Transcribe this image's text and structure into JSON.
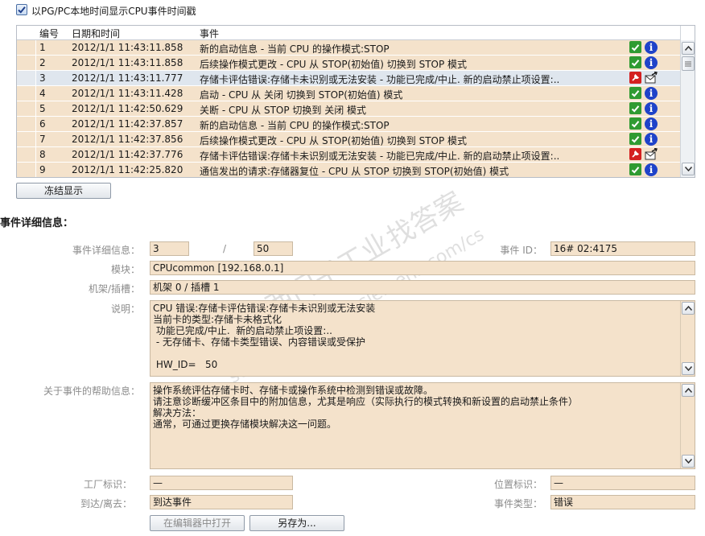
{
  "options": {
    "show_local_time_label": "以PG/PC本地时间显示CPU事件时间戳",
    "show_local_time_checked": true
  },
  "events_table": {
    "columns": [
      "编号",
      "日期和时间",
      "事件"
    ],
    "selected_row": 2,
    "rows": [
      {
        "num": "1",
        "datetime": "2012/1/1 11:43:11.858",
        "event": "新的启动信息 - 当前 CPU 的操作模式:STOP",
        "status": "ok"
      },
      {
        "num": "2",
        "datetime": "2012/1/1 11:43:11.858",
        "event": "后续操作模式更改  - CPU 从 STOP(初始值) 切换到 STOP 模式",
        "status": "ok"
      },
      {
        "num": "3",
        "datetime": "2012/1/1 11:43:11.777",
        "event": "存储卡评估错误:存储卡未识别或无法安装 - 功能已完成/中止.  新的启动禁止项设置:..",
        "status": "error"
      },
      {
        "num": "4",
        "datetime": "2012/1/1 11:43:11.428",
        "event": "启动  - CPU 从 关闭 切换到 STOP(初始值) 模式",
        "status": "ok"
      },
      {
        "num": "5",
        "datetime": "2012/1/1 11:42:50.629",
        "event": "关断  - CPU 从 STOP 切换到 关闭 模式",
        "status": "ok"
      },
      {
        "num": "6",
        "datetime": "2012/1/1 11:42:37.857",
        "event": "新的启动信息 - 当前 CPU 的操作模式:STOP",
        "status": "ok"
      },
      {
        "num": "7",
        "datetime": "2012/1/1 11:42:37.856",
        "event": "后续操作模式更改  - CPU 从 STOP(初始值) 切换到 STOP 模式",
        "status": "ok"
      },
      {
        "num": "8",
        "datetime": "2012/1/1 11:42:37.776",
        "event": "存储卡评估错误:存储卡未识别或无法安装 - 功能已完成/中止.  新的启动禁止项设置:..",
        "status": "error"
      },
      {
        "num": "9",
        "datetime": "2012/1/1 11:42:25.820",
        "event": "通信发出的请求:存储器复位  - CPU 从 STOP 切换到 STOP(初始值) 模式",
        "status": "ok"
      }
    ]
  },
  "freeze_button": "冻结显示",
  "details": {
    "section_title": "事件详细信息：",
    "detail_label": "事件详细信息：",
    "detail_index": "3",
    "slash": "/",
    "detail_total": "50",
    "event_id_label": "事件 ID：",
    "event_id": "16# 02:4175",
    "module_label": "模块：",
    "module": "CPUcommon [192.168.0.1]",
    "rack_slot_label": "机架/插槽：",
    "rack_slot": "机架 0 / 插槽 1",
    "description_label": "说明：",
    "description_lines": [
      "CPU 错误:存储卡评估错误:存储卡未识别或无法安装",
      "当前卡的类型:存储卡未格式化",
      " 功能已完成/中止.  新的启动禁止项设置:..",
      " - 无存储卡、存储卡类型错误、内容错误或受保护",
      "",
      " HW_ID=   50"
    ],
    "help_label": "关于事件的帮助信息：",
    "help_lines": [
      "操作系统评估存储卡时、存储卡或操作系统中检测到错误或故障。",
      "请注意诊断缓冲区条目中的附加信息，尤其是响应（实际执行的模式转换和新设置的启动禁止条件）",
      "解决方法：",
      "通常，可通过更换存储模块解决这一问题。"
    ],
    "plant_tag_label": "工厂标识：",
    "plant_tag": "—",
    "location_tag_label": "位置标识：",
    "location_tag": "—",
    "incoming_label": "到达/离去：",
    "incoming": "到达事件",
    "event_type_label": "事件类型：",
    "event_type": "错误"
  },
  "buttons": {
    "open_in_editor": "在编辑器中打开",
    "save_as": "另存为..."
  },
  "watermark_lines": [
    "找答案",
    "support.industry.siemens.com/cs",
    "西门子工业"
  ],
  "colors": {
    "row_bg": "#f4e2cb",
    "selected_row_bg": "#dfe6ee",
    "ok_green": "#2f9b32",
    "info_blue": "#1f43c9",
    "error_red": "#d42020"
  }
}
